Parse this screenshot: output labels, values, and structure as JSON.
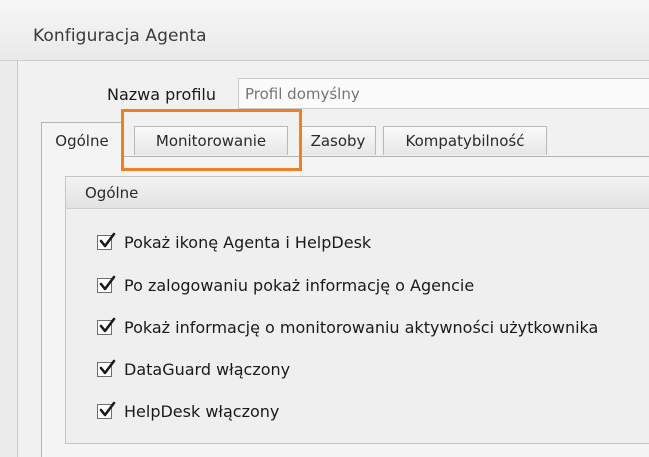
{
  "window": {
    "title": "Konfiguracja Agenta"
  },
  "profile": {
    "label": "Nazwa profilu",
    "placeholder": "Profil domyślny"
  },
  "tabs": [
    {
      "label": "Ogólne",
      "active": true
    },
    {
      "label": "Monitorowanie",
      "active": false
    },
    {
      "label": "Zasoby",
      "active": false
    },
    {
      "label": "Kompatybilność",
      "active": false
    }
  ],
  "group": {
    "title": "Ogólne",
    "options": [
      {
        "label": "Pokaż ikonę Agenta i HelpDesk",
        "checked": true
      },
      {
        "label": "Po zalogowaniu pokaż informację o Agencie",
        "checked": true
      },
      {
        "label": "Pokaż informację o monitorowaniu aktywności użytkownika",
        "checked": true
      },
      {
        "label": "DataGuard włączony",
        "checked": true
      },
      {
        "label": "HelpDesk włączony",
        "checked": true
      }
    ]
  },
  "colors": {
    "highlight": "#f07f22",
    "window_bg": "#ececec",
    "tab_border": "#b3b3b3",
    "check": "#1b1b1b"
  },
  "icons": {
    "checkbox_checked": "checkmark-icon",
    "highlight_box": "orange-highlight-frame"
  }
}
